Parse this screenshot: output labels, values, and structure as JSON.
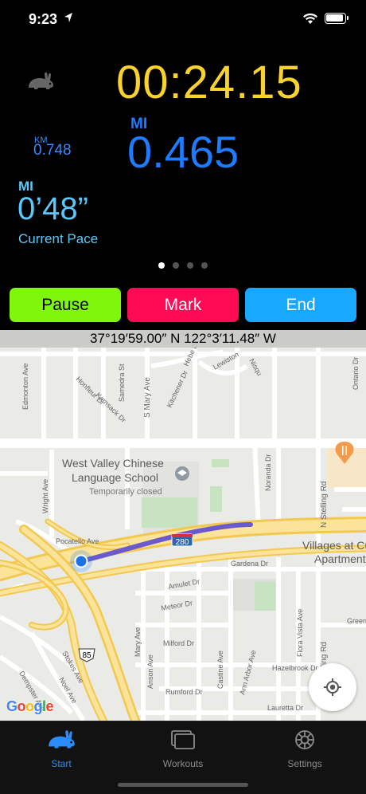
{
  "status_bar": {
    "time": "9:23"
  },
  "stats": {
    "timer": "00:24.15",
    "km_unit": "KM",
    "km_value": "0.748",
    "mi_unit": "MI",
    "mi_value": "0.465",
    "pace_unit": "MI",
    "pace_value": "0’48”",
    "pace_label": "Current Pace"
  },
  "page_indicator": {
    "count": 4,
    "active": 1
  },
  "buttons": {
    "pause": "Pause",
    "mark": "Mark",
    "end": "End"
  },
  "map": {
    "coordinates": "37°19′59.00″ N   122°3′11.48″ W",
    "poi_name_line1": "West Valley Chinese",
    "poi_name_line2": "Language School",
    "poi_status": "Temporarily closed",
    "poi_right_line1": "Villages at Cuper",
    "poi_right_line2": "Apartment Hom",
    "highway_shield": "280",
    "route_shield": "85",
    "google_logo": "Google",
    "streets": {
      "edmonton": "Edmonton Ave",
      "honfleur": "Honfleur Dr",
      "kamsack": "Kamsack Dr",
      "samedra": "Samedra St",
      "s_mary": "S Mary Ave",
      "kitchener": "Kitchener Dr",
      "hebe": "Hebe Dr",
      "lewiston": "Lewiston",
      "nisqually": "Nisqu",
      "ontario": "Ontario Dr",
      "wright": "Wright Ave",
      "pocatello": "Pocatello Ave",
      "noranda": "Noranda Dr",
      "n_stelling": "N Stelling Rd",
      "gardena": "Gardena Dr",
      "amulet": "Amulet Dr",
      "meteor": "Meteor Dr",
      "milford": "Milford Dr",
      "mary": "Mary Ave",
      "anson": "Anson Ave",
      "castine": "Castine Ave",
      "ann_arbor": "Ann Arbor Ave",
      "flora_vista": "Flora Vista Ave",
      "stelling": "elling Rd",
      "hazelbrook": "Hazelbrook Dr",
      "green": "Green",
      "rumford": "Rumford Dr",
      "lauretta": "Lauretta Dr",
      "dempster": "Dempster Ave",
      "stokes": "Stokes Ave",
      "noel": "Noel Ave"
    }
  },
  "tabbar": {
    "start": "Start",
    "workouts": "Workouts",
    "settings": "Settings"
  },
  "colors": {
    "timer": "#f9d22c",
    "distance": "#1f7bff",
    "pace": "#5ac8fa",
    "pause": "#7ef70a",
    "mark": "#ff0a55",
    "end": "#18a8ff",
    "route": "#6b5acd"
  }
}
